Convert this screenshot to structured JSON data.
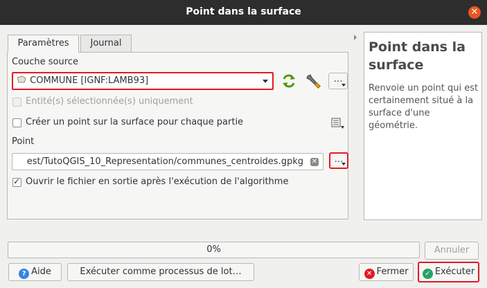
{
  "window": {
    "title": "Point dans la surface"
  },
  "tabs": [
    {
      "label": "Paramètres"
    },
    {
      "label": "Journal"
    }
  ],
  "params": {
    "source_label": "Couche source",
    "source_value": "COMMUNE [IGNF:LAMB93]",
    "selected_only_label": "Entité(s) sélectionnée(s) uniquement",
    "each_part_label": "Créer un point sur la surface pour chaque partie",
    "point_label": "Point",
    "point_path": "est/TutoQGIS_10_Representation/communes_centroides.gpkg",
    "open_output_label": "Ouvrir le fichier en sortie après l'exécution de l'algorithme",
    "dots": "…"
  },
  "help": {
    "title": "Point dans la surface",
    "description": "Renvoie un point qui est certainement situé à la surface d'une géométrie."
  },
  "progress": {
    "percent_text": "0%"
  },
  "buttons": {
    "cancel": "Annuler",
    "help": "Aide",
    "batch": "Exécuter comme processus de lot…",
    "close": "Fermer",
    "run": "Exécuter"
  }
}
